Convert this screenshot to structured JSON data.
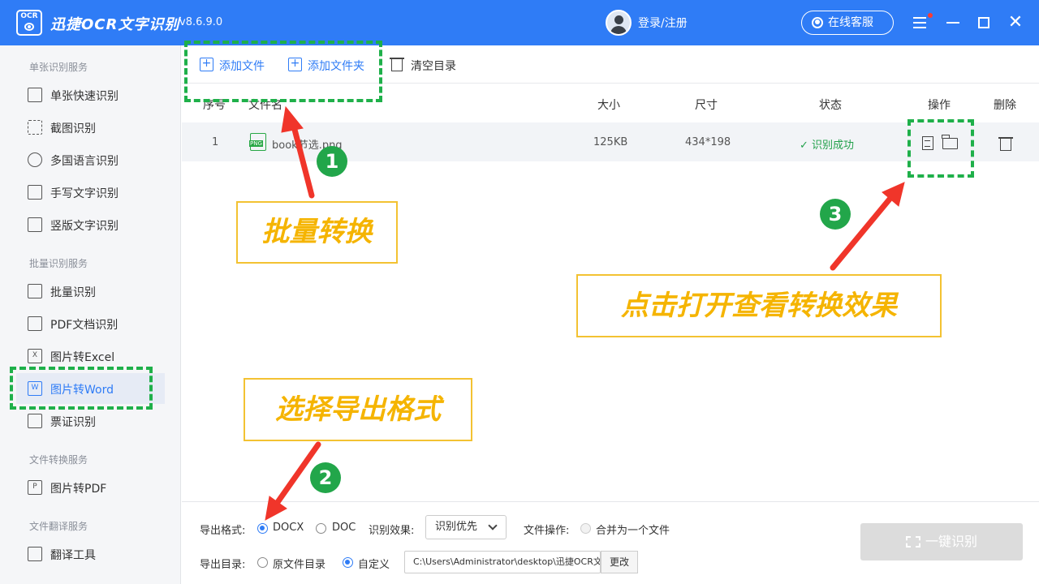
{
  "app": {
    "logo_text": "OCR",
    "title": "迅捷OCR文字识别",
    "version": "v8.6.9.0",
    "login": "登录/注册",
    "service": "在线客服",
    "close_glyph": "✕"
  },
  "sidebar": {
    "sections": [
      "单张识别服务",
      "批量识别服务",
      "文件转换服务",
      "文件翻译服务"
    ],
    "single": [
      "单张快速识别",
      "截图识别",
      "多国语言识别",
      "手写文字识别",
      "竖版文字识别"
    ],
    "batch": [
      "批量识别",
      "PDF文档识别",
      "图片转Excel",
      "图片转Word",
      "票证识别"
    ],
    "convert": [
      "图片转PDF"
    ],
    "translate": [
      "翻译工具"
    ],
    "icon_letters": {
      "excel": "X",
      "word": "W",
      "pdf": "P"
    }
  },
  "toolbar": {
    "add_file": "添加文件",
    "add_folder": "添加文件夹",
    "clear": "清空目录"
  },
  "table": {
    "headers": {
      "index": "序号",
      "name": "文件名",
      "size": "大小",
      "dims": "尺寸",
      "status": "状态",
      "action": "操作",
      "delete": "删除"
    },
    "rows": [
      {
        "index": "1",
        "name": "book节选.png",
        "size": "125KB",
        "dims": "434*198",
        "status": "✓ 识别成功",
        "file_type": "PNG"
      }
    ]
  },
  "footer": {
    "format_label": "导出格式:",
    "format_options": [
      "DOCX",
      "DOC"
    ],
    "format_selected": "DOCX",
    "effect_label": "识别效果:",
    "effect_value": "识别优先",
    "file_op_label": "文件操作:",
    "merge_label": "合并为一个文件",
    "dir_label": "导出目录:",
    "dir_options": [
      "原文件目录",
      "自定义"
    ],
    "dir_selected": "自定义",
    "path": "C:\\Users\\Administrator\\desktop\\迅捷OCR文字识别",
    "change": "更改",
    "start": "一键识别"
  },
  "annotations": {
    "batch": "批量转换",
    "format": "选择导出格式",
    "open": "点击打开查看转换效果",
    "badges": [
      "1",
      "2",
      "3"
    ],
    "colors": {
      "dash": "#1fb04a",
      "arrow": "#f0352a",
      "callout_text": "#f5b400",
      "callout_border": "#f3c232"
    }
  },
  "theme": {
    "primary": "#2f7cf6",
    "success": "#22a04b"
  }
}
